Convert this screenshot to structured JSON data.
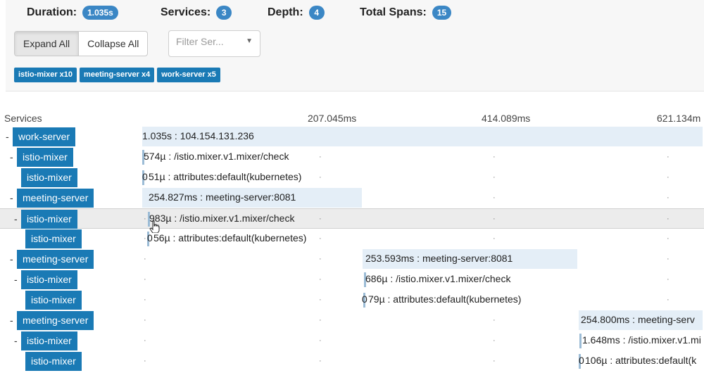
{
  "summary": {
    "duration_label": "Duration:",
    "duration_value": "1.035s",
    "services_label": "Services:",
    "services_value": "3",
    "depth_label": "Depth:",
    "depth_value": "4",
    "total_spans_label": "Total Spans:",
    "total_spans_value": "15"
  },
  "controls": {
    "expand_all": "Expand All",
    "collapse_all": "Collapse All",
    "filter_placeholder": "Filter Ser..."
  },
  "service_tags": [
    "istio-mixer x10",
    "meeting-server x4",
    "work-server x5"
  ],
  "timeline": {
    "services_header": "Services",
    "ticks": [
      "207.045ms",
      "414.089ms",
      "621.134m"
    ]
  },
  "spans": [
    {
      "service": "work-server",
      "label": "1.035s : 104.154.131.236",
      "toggle": "-"
    },
    {
      "service": "istio-mixer",
      "label": "574µ : /istio.mixer.v1.mixer/check",
      "toggle": "-"
    },
    {
      "service": "istio-mixer",
      "label": "51µ : attributes:default(kubernetes)",
      "prefix": "0",
      "toggle": ""
    },
    {
      "service": "meeting-server",
      "label": "254.827ms : meeting-server:8081",
      "toggle": "-"
    },
    {
      "service": "istio-mixer",
      "label": "983µ : /istio.mixer.v1.mixer/check",
      "toggle": "-"
    },
    {
      "service": "istio-mixer",
      "label": "56µ : attributes:default(kubernetes)",
      "prefix": "0",
      "toggle": ""
    },
    {
      "service": "meeting-server",
      "label": "253.593ms : meeting-server:8081",
      "toggle": "-"
    },
    {
      "service": "istio-mixer",
      "label": "686µ : /istio.mixer.v1.mixer/check",
      "toggle": "-"
    },
    {
      "service": "istio-mixer",
      "label": "79µ : attributes:default(kubernetes)",
      "prefix": "0",
      "toggle": ""
    },
    {
      "service": "meeting-server",
      "label": "254.800ms : meeting-serv",
      "toggle": "-"
    },
    {
      "service": "istio-mixer",
      "label": "1.648ms : /istio.mixer.v1.mi",
      "toggle": "-"
    },
    {
      "service": "istio-mixer",
      "label": "106µ : attributes:default(k",
      "prefix": "0",
      "toggle": ""
    }
  ],
  "colors": {
    "badge": "#3b87c5",
    "service": "#1a7ab5",
    "bar": "#e4eef7"
  }
}
